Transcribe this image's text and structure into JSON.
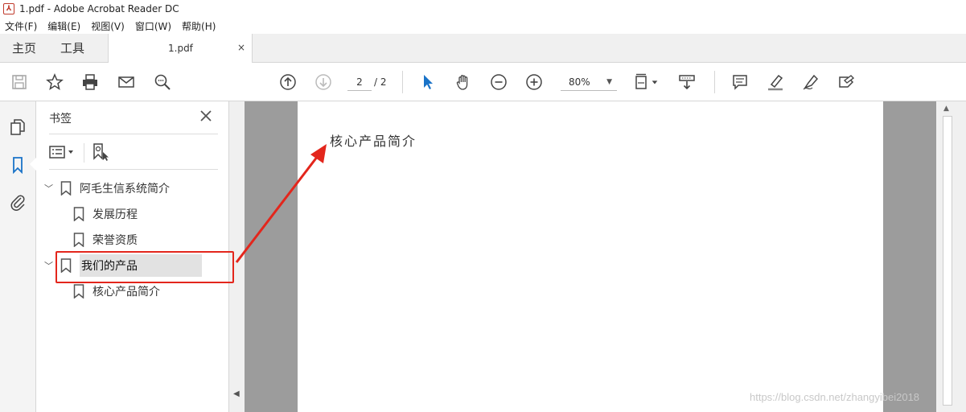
{
  "window": {
    "title": "1.pdf - Adobe Acrobat Reader DC",
    "app_icon": "acrobat-pdf-icon"
  },
  "menubar": {
    "items": [
      "文件(F)",
      "编辑(E)",
      "视图(V)",
      "窗口(W)",
      "帮助(H)"
    ]
  },
  "tabs": {
    "home": "主页",
    "tools": "工具",
    "document": "1.pdf",
    "close": "×"
  },
  "toolbar": {
    "page_current": "2",
    "page_total": "/ 2",
    "zoom": "80%",
    "icons": [
      "save-icon",
      "star-icon",
      "print-icon",
      "email-icon",
      "search-zoom-icon",
      "page-up-icon",
      "page-down-icon",
      "select-cursor-icon",
      "hand-icon",
      "zoom-out-icon",
      "zoom-in-icon",
      "fit-page-icon",
      "scroll-mode-icon",
      "comment-icon",
      "highlight-icon",
      "sign-icon",
      "fill-sign-icon"
    ]
  },
  "left_rail": {
    "icons": [
      "pages-icon",
      "bookmark-icon",
      "attachment-icon"
    ]
  },
  "bookmark_panel": {
    "title": "书签",
    "close": "✕",
    "items": [
      {
        "label": "阿毛生信系统简介",
        "level": 0,
        "expanded": true
      },
      {
        "label": "发展历程",
        "level": 1
      },
      {
        "label": "荣誉资质",
        "level": 1
      },
      {
        "label": "我们的产品",
        "level": 0,
        "expanded": true,
        "selected": true
      },
      {
        "label": "核心产品简介",
        "level": 1
      }
    ]
  },
  "document": {
    "heading": "核心产品简介"
  },
  "annotation": {
    "color": "#e3261c"
  },
  "watermark": "https://blog.csdn.net/zhangyibei2018"
}
